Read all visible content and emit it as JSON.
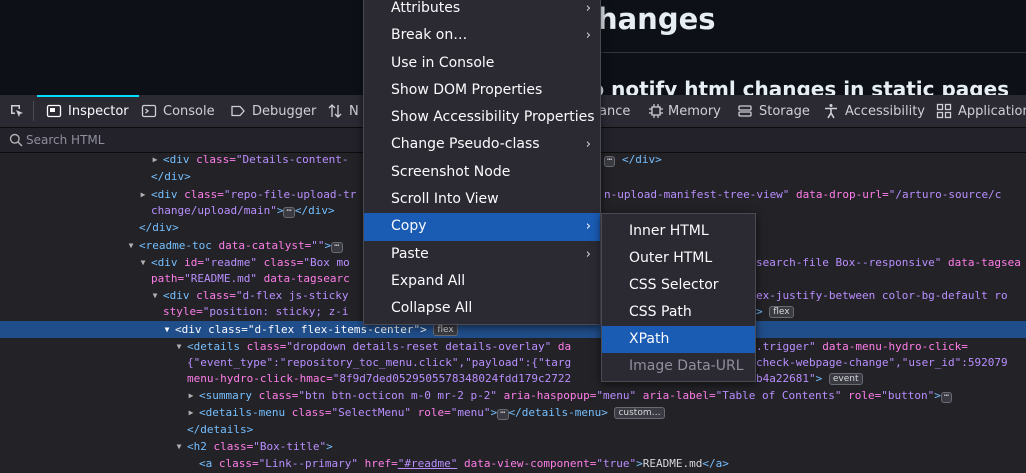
{
  "page": {
    "title": "e changes",
    "subtitle": "pt to notify html changes in static pages"
  },
  "toolbar": {
    "tabs": [
      {
        "label": "Inspector",
        "icon": "inspector-icon"
      },
      {
        "label": "Console",
        "icon": "console-icon"
      },
      {
        "label": "Debugger",
        "icon": "debugger-icon"
      },
      {
        "label": "N",
        "icon": "network-icon"
      },
      {
        "label": "ance",
        "icon": "performance-icon"
      },
      {
        "label": "Memory",
        "icon": "memory-icon"
      },
      {
        "label": "Storage",
        "icon": "storage-icon"
      },
      {
        "label": "Accessibility",
        "icon": "accessibility-icon"
      },
      {
        "label": "Application",
        "icon": "application-icon"
      }
    ],
    "selected": "Inspector"
  },
  "search": {
    "placeholder": "Search HTML"
  },
  "markup": {
    "l0": [
      "<div ",
      "class=",
      "\"Details-content-",
      "</div>"
    ],
    "l1": "</div>",
    "l2": [
      "<div ",
      "class=",
      "\"repo-file-upload-tr",
      "n-upload-manifest-tree-view\"",
      " data-drop-url=",
      "\"/arturo-source/c"
    ],
    "l3": [
      "change/upload/main\"",
      "</div>"
    ],
    "l4": "</div>",
    "l5": [
      "<readme-toc ",
      "data-catalyst=",
      "\"\"",
      ">"
    ],
    "l6": [
      "<div ",
      "id=",
      "\"readme\"",
      " class=",
      "\"Box mo",
      "search-file Box--responsive\"",
      " data-tagsea"
    ],
    "l7": [
      "path=",
      "\"README.md\"",
      " data-tagsearc"
    ],
    "l8": [
      "<div ",
      "class=",
      "\"d-flex js-sticky",
      "ex-justify-between color-bg-default ro"
    ],
    "l9": [
      "style=",
      "\"position: sticky; z-i",
      ">"
    ],
    "l10": [
      "<div ",
      "class=",
      "\"d-flex flex-items-center\"",
      ">"
    ],
    "l11": [
      "<details ",
      "class=",
      "\"dropdown details-reset details-overlay\"",
      " da",
      ".trigger\"",
      " data-menu-hydro-click="
    ],
    "l12": [
      "{\"event_type\":\"repository_toc_menu.click\",\"payload\":{\"targ",
      "check-webpage-change\",\"user_id\":592079"
    ],
    "l13": [
      "menu-hydro-click-hmac=",
      "\"8f9d7ded0529505578348024fdd179c2722",
      "b4a22681\"",
      ">"
    ],
    "l14": [
      "<summary ",
      "class=",
      "\"btn btn-octicon m-0 mr-2 p-2\"",
      " aria-haspopup=",
      "\"menu\"",
      " aria-label=",
      "\"Table of Contents\"",
      " role=",
      "\"button\"",
      ">"
    ],
    "l15": [
      "<details-menu ",
      "class=",
      "\"SelectMenu\"",
      " role=",
      "\"menu\"",
      ">",
      "</details-menu>"
    ],
    "l16": "</details>",
    "l17": [
      "<h2 ",
      "class=",
      "\"Box-title\"",
      ">"
    ],
    "l18": [
      "<a ",
      "class=",
      "\"Link--primary\"",
      " href=",
      "\"#readme\"",
      " data-view-component=",
      "\"true\"",
      ">",
      "README.md",
      "</a>"
    ],
    "badges": {
      "flex": "flex",
      "event": "event",
      "custom": "custom…",
      "ellipsis": "⋯"
    }
  },
  "context_menu": {
    "items": [
      {
        "label": "Attributes",
        "submenu": true
      },
      {
        "label": "Break on…",
        "submenu": true
      },
      {
        "label": "Use in Console",
        "submenu": false
      },
      {
        "label": "Show DOM Properties",
        "submenu": false
      },
      {
        "label": "Show Accessibility Properties",
        "submenu": false
      },
      {
        "label": "Change Pseudo-class",
        "submenu": true
      },
      {
        "label": "Screenshot Node",
        "submenu": false
      },
      {
        "label": "Scroll Into View",
        "submenu": false
      },
      {
        "label": "Copy",
        "submenu": true,
        "active": true
      },
      {
        "label": "Paste",
        "submenu": true
      },
      {
        "label": "Expand All",
        "submenu": false
      },
      {
        "label": "Collapse All",
        "submenu": false
      }
    ]
  },
  "copy_menu": {
    "items": [
      {
        "label": "Inner HTML"
      },
      {
        "label": "Outer HTML"
      },
      {
        "label": "CSS Selector"
      },
      {
        "label": "CSS Path"
      },
      {
        "label": "XPath",
        "active": true
      },
      {
        "label": "Image Data-URL",
        "disabled": true
      }
    ]
  },
  "colors": {
    "selection": "#204e8a",
    "menu_highlight": "#1a5bb4",
    "tag": "#75bfff",
    "attr": "#ff7de9",
    "value": "#b98eff",
    "tab_indicator": "#00ddff"
  }
}
